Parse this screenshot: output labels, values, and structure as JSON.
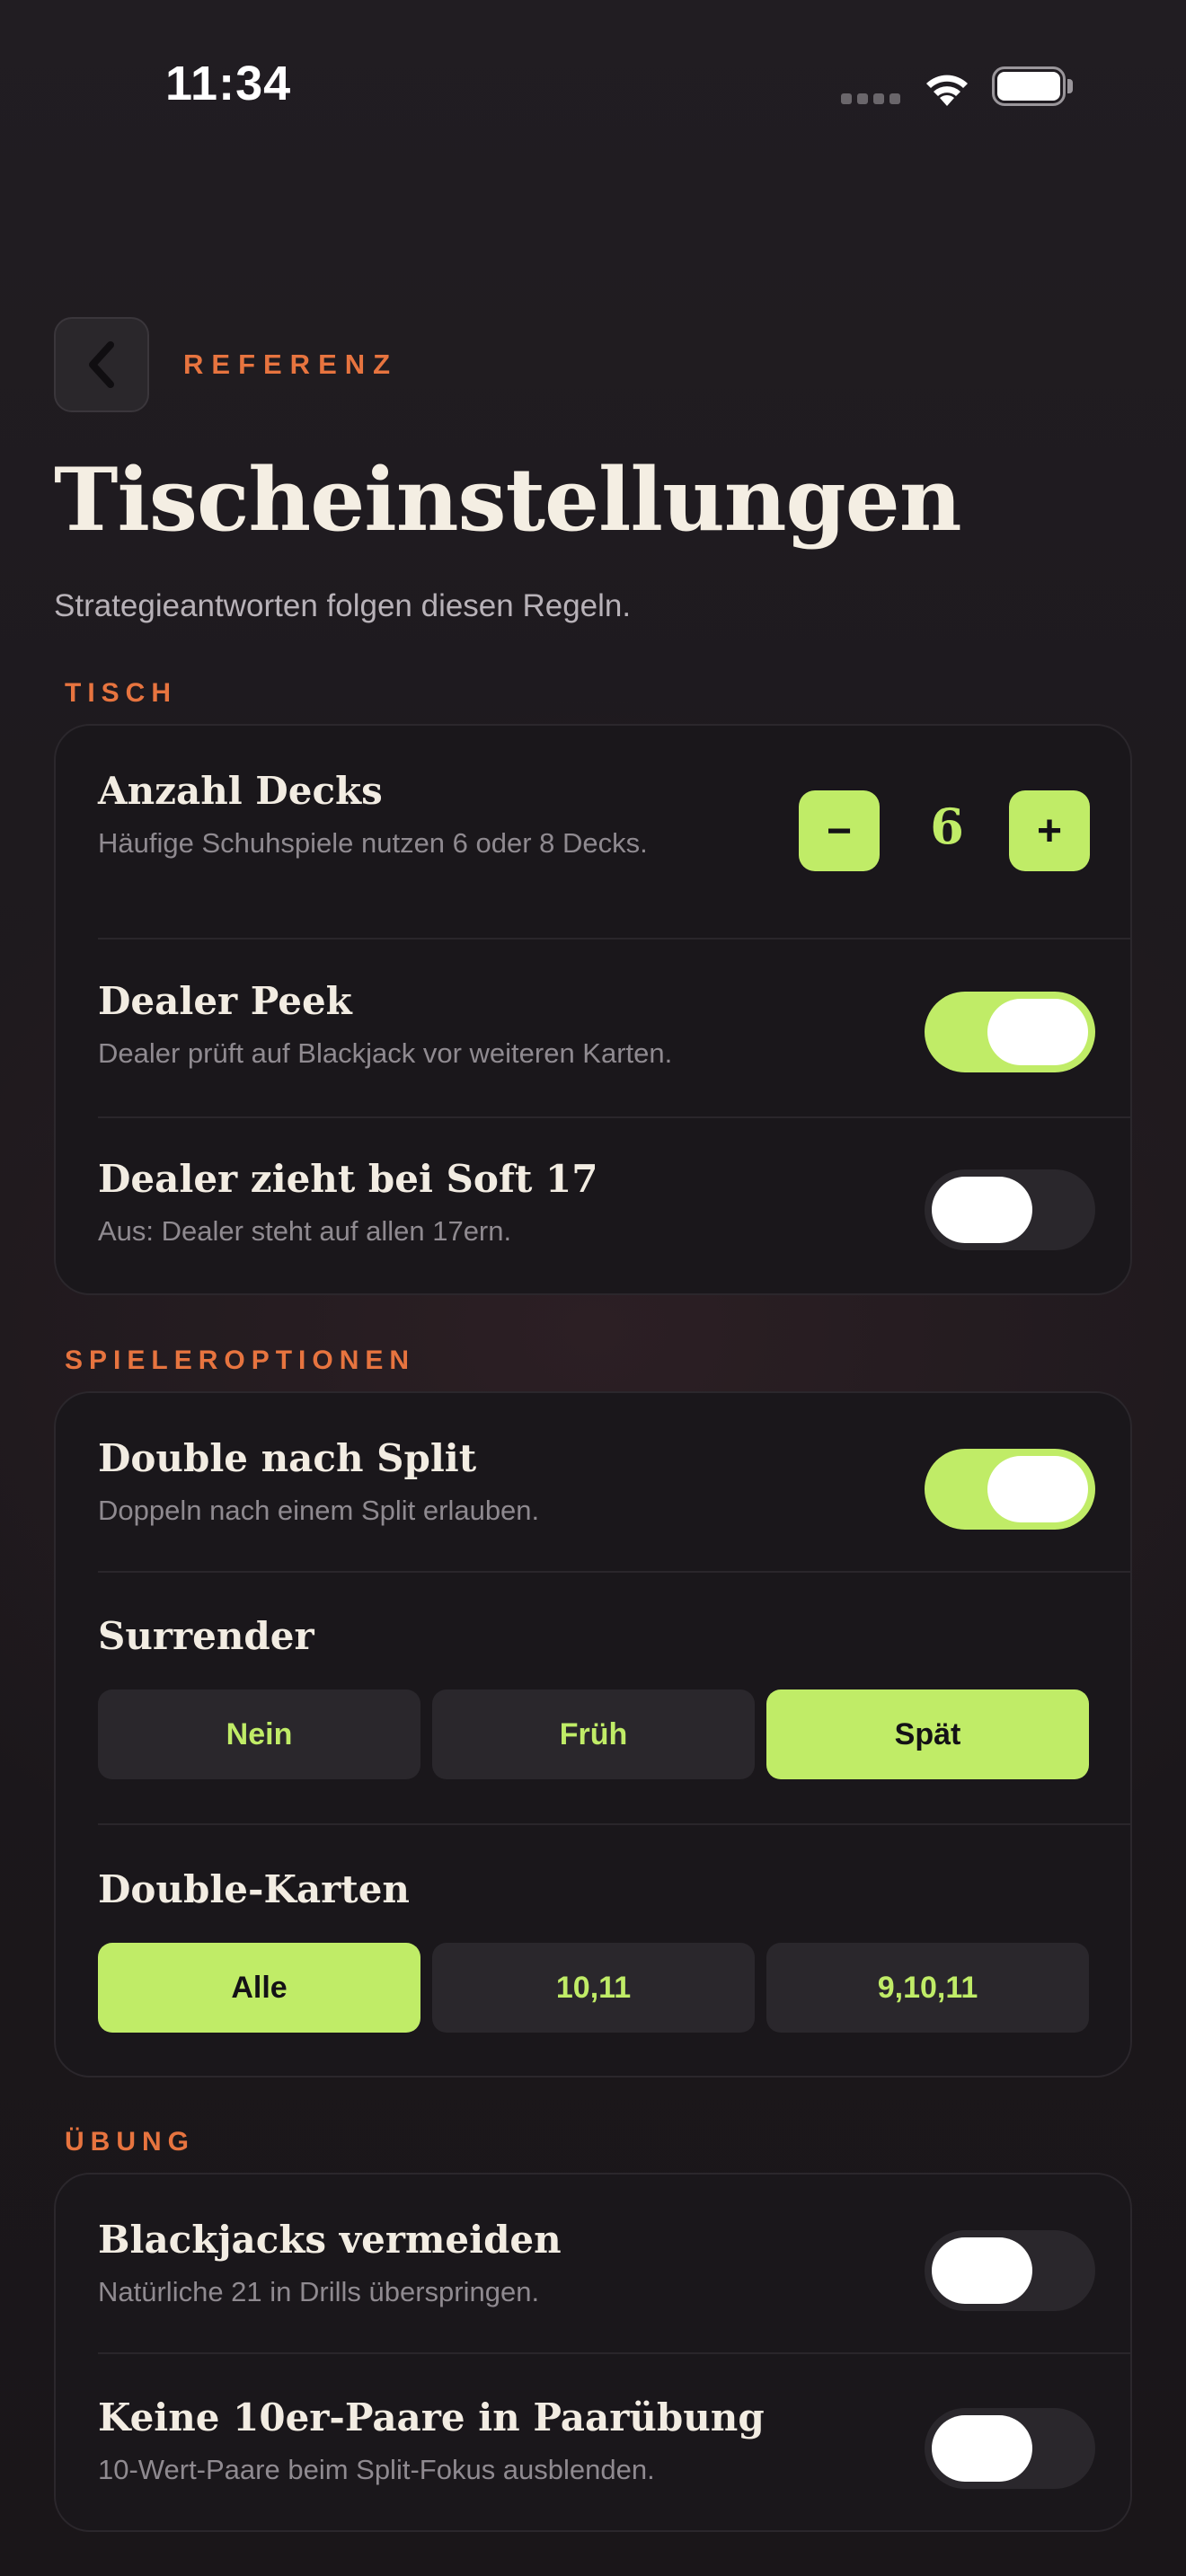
{
  "status_bar": {
    "time": "11:34"
  },
  "header": {
    "eyebrow": "REFERENZ",
    "title": "Tischeinstellungen",
    "subtitle": "Strategieantworten folgen diesen Regeln."
  },
  "sections": {
    "table": {
      "label": "TISCH",
      "decks": {
        "title": "Anzahl Decks",
        "desc": "Häufige Schuhspiele nutzen 6 oder 8 Decks.",
        "value": "6",
        "minus": "−",
        "plus": "+"
      },
      "peek": {
        "title": "Dealer Peek",
        "desc": "Dealer prüft auf Blackjack vor weiteren Karten.",
        "on": true
      },
      "soft17": {
        "title": "Dealer zieht bei Soft 17",
        "desc": "Aus: Dealer steht auf allen 17ern.",
        "on": false
      }
    },
    "player": {
      "label": "SPIELEROPTIONEN",
      "das": {
        "title": "Double nach Split",
        "desc": "Doppeln nach einem Split erlauben.",
        "on": true
      },
      "surrender": {
        "title": "Surrender",
        "options": [
          "Nein",
          "Früh",
          "Spät"
        ],
        "selected": "Spät"
      },
      "double_cards": {
        "title": "Double-Karten",
        "options": [
          "Alle",
          "10,11",
          "9,10,11"
        ],
        "selected": "Alle"
      }
    },
    "practice": {
      "label": "ÜBUNG",
      "avoid_bj": {
        "title": "Blackjacks vermeiden",
        "desc": "Natürliche 21 in Drills überspringen.",
        "on": false
      },
      "no_ten_pairs": {
        "title": "Keine 10er-Paare in Paarübung",
        "desc": "10-Wert-Paare beim Split-Fokus ausblenden.",
        "on": false
      }
    }
  },
  "colors": {
    "accent": "#c0ec67",
    "section_label": "#e7743f",
    "card": "#1a171b",
    "background": "#1e1a1e"
  },
  "icons": [
    "wifi-icon",
    "battery-icon",
    "cellular-signal-icon",
    "chevron-left-icon"
  ]
}
